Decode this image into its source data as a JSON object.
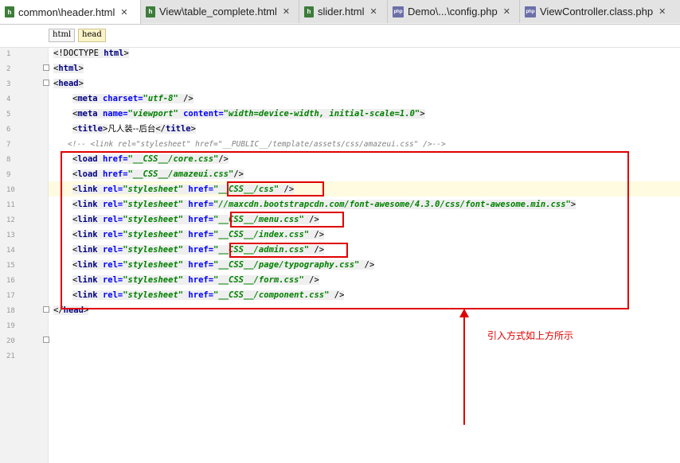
{
  "tabs": [
    {
      "label": "common\\header.html",
      "icon": "html-file-icon",
      "active": true
    },
    {
      "label": "View\\table_complete.html",
      "icon": "html-file-icon",
      "active": false
    },
    {
      "label": "slider.html",
      "icon": "html-file-icon",
      "active": false
    },
    {
      "label": "Demo\\...\\config.php",
      "icon": "php-file-icon",
      "active": false
    },
    {
      "label": "ViewController.class.php",
      "icon": "php-file-icon",
      "active": false
    }
  ],
  "icon_glyphs": {
    "html": "h",
    "php": "php",
    "close": "✕"
  },
  "breadcrumb": [
    "html",
    "head"
  ],
  "line_numbers": [
    "1",
    "2",
    "3",
    "4",
    "5",
    "6",
    "7",
    "8",
    "9",
    "10",
    "11",
    "12",
    "13",
    "14",
    "15",
    "16",
    "17",
    "18",
    "19",
    "20",
    "21"
  ],
  "code": {
    "l1": {
      "open": "<!DOCTYPE ",
      "kw": "html",
      "close": ">"
    },
    "l2": {
      "open": "<",
      "tag": "html",
      "close": ">"
    },
    "l3": {
      "open": "<",
      "tag": "head",
      "close": ">"
    },
    "l4": {
      "open": "<",
      "tag": "meta ",
      "attr1": "charset=",
      "val1": "\"utf-8\"",
      "close": " />"
    },
    "l5": {
      "open": "<",
      "tag": "meta ",
      "attr1": "name=",
      "val1": "\"viewport\" ",
      "attr2": "content=",
      "val2": "\"width=device-width, initial-scale=1.0\"",
      "close": ">"
    },
    "l6": {
      "open": "<",
      "tag": "title",
      "mid": ">",
      "text": "凡人装--后台",
      "close_open": "</",
      "close_tag": "title",
      "close": ">"
    },
    "l7": "<!-- <link rel=\"stylesheet\" href=\"__PUBLIC__/template/assets/css/amazeui.css\" />-->",
    "l8": {
      "open": "<",
      "tag": "load ",
      "attr1": "href=",
      "val1": "\"__CSS__/core.css\"",
      "close": "/>"
    },
    "l9": {
      "open": "<",
      "tag": "load ",
      "attr1": "href=",
      "val1": "\"__CSS__/amazeui.css\"",
      "close": "/>"
    },
    "link_common": {
      "open": "<",
      "tag": "link ",
      "rel": "rel=",
      "relval": "\"stylesheet\" ",
      "href": "href="
    },
    "l10": {
      "val": "\"__CSS__/css\"",
      "close": " />"
    },
    "l11": {
      "val": "\"//maxcdn.bootstrapcdn.com/font-awesome/4.3.0/css/font-awesome.min.css\"",
      "close": ">"
    },
    "l12": {
      "val": "\"__CSS__/menu.css\"",
      "close": " />"
    },
    "l13": {
      "val": "\"__CSS__/index.css\"",
      "close": " />"
    },
    "l14": {
      "val": "\"__CSS__/admin.css\"",
      "close": " />"
    },
    "l15": {
      "val": "\"__CSS__/page/typography.css\"",
      "close": " />"
    },
    "l16": {
      "val": "\"__CSS__/form.css\"",
      "close": " />"
    },
    "l17": {
      "val": "\"__CSS__/component.css\"",
      "close": " />"
    },
    "l18": {
      "open": "</",
      "tag": "head",
      "close": ">"
    }
  },
  "annotation": {
    "note": "引入方式如上方所示",
    "color": "#e00000"
  }
}
